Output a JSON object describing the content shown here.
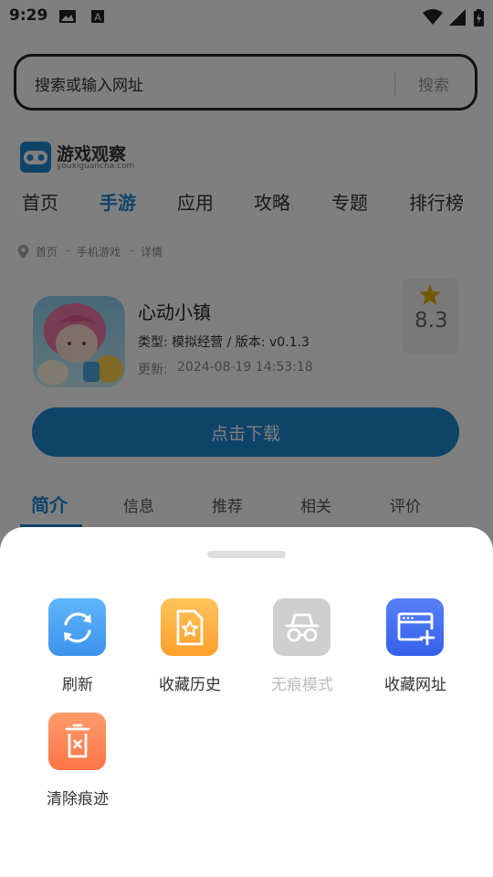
{
  "status_bar": {
    "time": "9:29"
  },
  "search": {
    "placeholder": "搜索或输入网址",
    "button_label": "搜索"
  },
  "site": {
    "name": "游戏观察",
    "domain": "youxiguancha.com"
  },
  "nav": [
    "首页",
    "手游",
    "应用",
    "攻略",
    "专题",
    "排行榜"
  ],
  "breadcrumb": [
    "首页",
    "-",
    "手机游戏",
    "-",
    "详情"
  ],
  "app": {
    "name": "心动小镇",
    "meta": "类型: 模拟经营 / 版本: v0.1.3",
    "update_label": "更新:",
    "update_time": "2024-08-19 14:53:18",
    "rating": "8.3",
    "download_label": "点击下载"
  },
  "tabs": [
    "简介",
    "信息",
    "推荐",
    "相关",
    "评价"
  ],
  "sheet": {
    "actions": [
      {
        "label": "刷新",
        "icon": "refresh-icon",
        "color": "#4aa6f5"
      },
      {
        "label": "收藏历史",
        "icon": "star-document-icon",
        "color": "#ffb03b"
      },
      {
        "label": "无痕模式",
        "icon": "incognito-icon",
        "color": "#cccccc",
        "disabled": true
      },
      {
        "label": "收藏网址",
        "icon": "add-bookmark-icon",
        "color": "#3f6ef0"
      },
      {
        "label": "清除痕迹",
        "icon": "trash-icon",
        "color": "#ff8458"
      }
    ]
  },
  "colors": {
    "accent": "#1e88d3",
    "overlay": "rgba(0,0,0,0.5)"
  }
}
